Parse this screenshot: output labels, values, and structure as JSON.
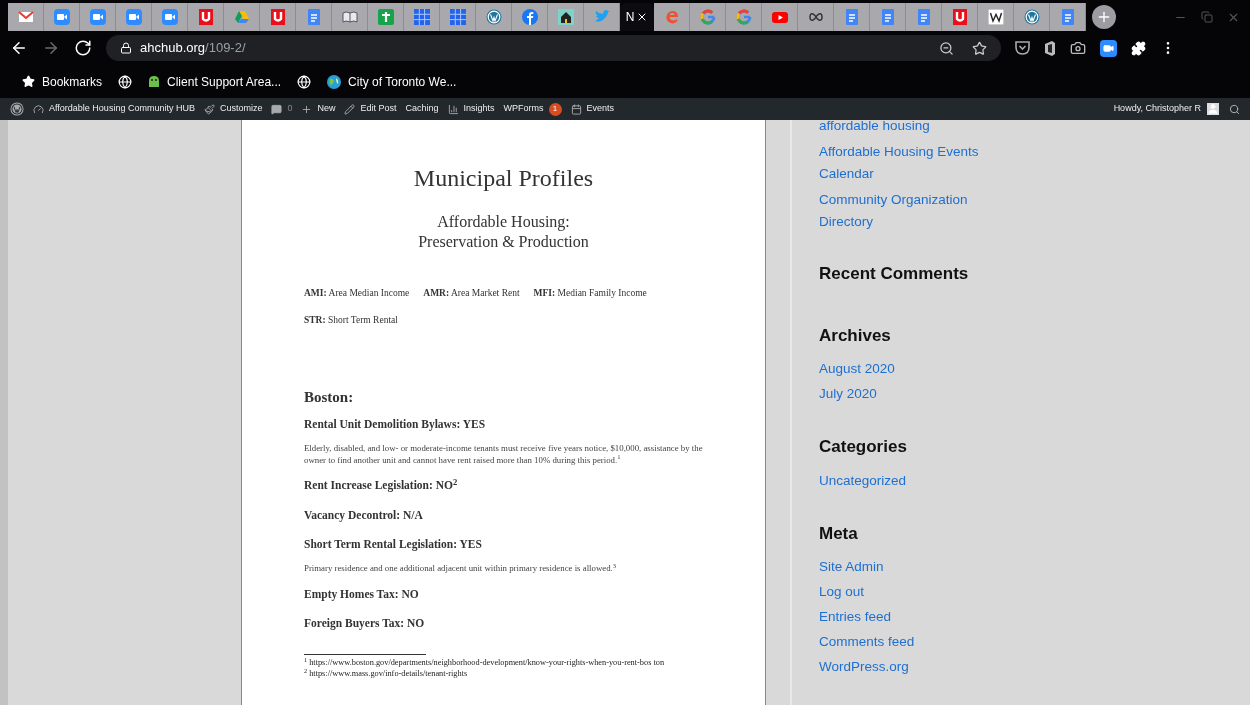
{
  "browser": {
    "tabs": [
      {
        "kind": "gmail",
        "selected": false
      },
      {
        "kind": "zoom",
        "selected": false
      },
      {
        "kind": "zoom",
        "selected": false
      },
      {
        "kind": "zoom",
        "selected": false
      },
      {
        "kind": "zoom",
        "selected": false
      },
      {
        "kind": "u",
        "selected": false
      },
      {
        "kind": "drive",
        "selected": false
      },
      {
        "kind": "u",
        "selected": false
      },
      {
        "kind": "docs",
        "selected": false
      },
      {
        "kind": "book",
        "selected": false
      },
      {
        "kind": "cross",
        "selected": false
      },
      {
        "kind": "grid",
        "selected": false
      },
      {
        "kind": "grid",
        "selected": false
      },
      {
        "kind": "wordpress",
        "selected": false
      },
      {
        "kind": "facebook",
        "selected": false
      },
      {
        "kind": "house",
        "selected": false
      },
      {
        "kind": "bird",
        "selected": false
      },
      {
        "kind": "text",
        "title": "N",
        "selected": true
      },
      {
        "kind": "e",
        "selected": false
      },
      {
        "kind": "google",
        "selected": false
      },
      {
        "kind": "google",
        "selected": false
      },
      {
        "kind": "youtube",
        "selected": false
      },
      {
        "kind": "cn",
        "selected": false
      },
      {
        "kind": "docs",
        "selected": false
      },
      {
        "kind": "docs",
        "selected": false
      },
      {
        "kind": "docs",
        "selected": false
      },
      {
        "kind": "u",
        "selected": false
      },
      {
        "kind": "wiki",
        "selected": false
      },
      {
        "kind": "wordpress",
        "selected": false
      },
      {
        "kind": "docs",
        "selected": false
      }
    ],
    "nav": [
      {
        "kind": "back",
        "disabled": false
      },
      {
        "kind": "forward",
        "disabled": true
      },
      {
        "kind": "reload",
        "disabled": false
      }
    ],
    "address": {
      "host": "ahchub.org",
      "path": "/109-2/"
    },
    "bookmarks": [
      {
        "kind": "star",
        "label": "Bookmarks"
      },
      {
        "kind": "globe"
      },
      {
        "kind": "android",
        "label": "Client Support Area..."
      },
      {
        "kind": "globe"
      },
      {
        "kind": "earth",
        "label": "City of Toronto We..."
      }
    ]
  },
  "admin_bar": {
    "items": [
      {
        "kind": "wp"
      },
      {
        "kind": "dashboard",
        "label": "Affordable Housing Community HUB"
      },
      {
        "kind": "brush",
        "label": "Customize"
      },
      {
        "kind": "comment",
        "label": "0"
      },
      {
        "kind": "plus",
        "label": "New"
      },
      {
        "kind": "pencil",
        "label": "Edit Post"
      },
      {
        "kind": "none",
        "label": "Caching"
      },
      {
        "kind": "bars",
        "label": "Insights"
      },
      {
        "kind": "none",
        "label": "WPForms",
        "badge": "1"
      },
      {
        "kind": "calendar",
        "label": "Events"
      }
    ],
    "user": "Howdy, Christopher R"
  },
  "document": {
    "title": "Municipal Profiles",
    "subtitle": [
      "Affordable Housing:",
      "Preservation & Production"
    ],
    "abbreviations": [
      [
        "**AMI:** Area Median Income",
        "**AMR:** Area Market Rent",
        "**MFI:** Median Family Income"
      ],
      [
        "**STR:** Short Term Rental"
      ]
    ],
    "city": "Boston:",
    "blocks": [
      {
        "kind": "heading",
        "text": "Rental Unit Demolition Bylaws: YES"
      },
      {
        "kind": "paragraph",
        "text": "Elderly, disabled, and low- or moderate-income tenants must receive five years notice, $10,000, assistance by the owner to find another unit and cannot have rent raised more than 10% during this period.$^{1}$"
      },
      {
        "kind": "heading",
        "text": "Rent Increase Legislation: NO$^{2}$"
      },
      {
        "kind": "heading",
        "text": "Vacancy Decontrol: N/A"
      },
      {
        "kind": "heading",
        "text": "Short Term Rental Legislation: YES"
      },
      {
        "kind": "paragraph",
        "text": "Primary residence and one additional adjacent unit within primary residence is allowed.$^{3}$"
      },
      {
        "kind": "heading",
        "text": "Empty Homes Tax: NO"
      },
      {
        "kind": "heading",
        "text": "Foreign Buyers Tax: NO"
      }
    ],
    "footnotes": [
      {
        "mark": "1",
        "text": "https://www.boston.gov/departments/neighborhood-development/know-your-rights-when-you-rent-bos ton"
      },
      {
        "mark": "2",
        "text": "https://www.mass.gov/info-details/tenant-rights"
      }
    ]
  },
  "sidebar": {
    "top_links": [
      "affordable housing",
      "Affordable Housing Events Calendar",
      "Community Organization Directory"
    ],
    "widgets": [
      {
        "title": "Recent Comments"
      },
      {
        "title": "Archives",
        "links": [
          "August 2020",
          "July 2020"
        ]
      },
      {
        "title": "Categories",
        "links": [
          "Uncategorized"
        ]
      },
      {
        "title": "Meta",
        "links": [
          "Site Admin",
          "Log out",
          "Entries feed",
          "Comments feed",
          "WordPress.org"
        ]
      }
    ]
  }
}
